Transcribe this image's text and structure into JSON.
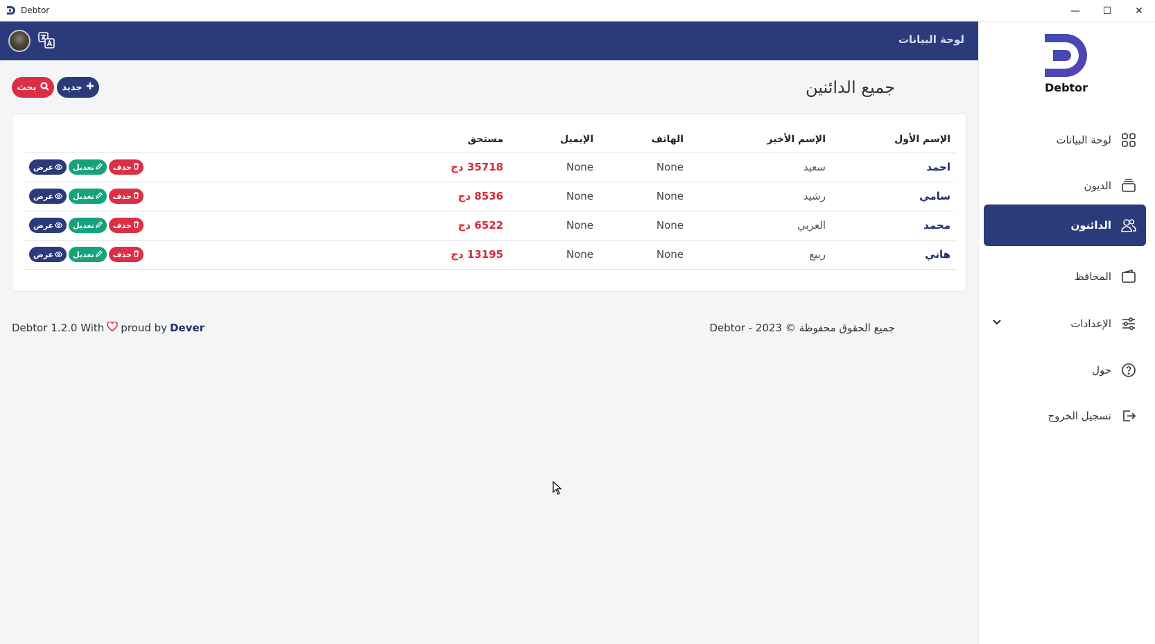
{
  "window": {
    "title": "Debtor",
    "minimize": "—",
    "maximize": "☐",
    "close": "✕"
  },
  "header": {
    "crumb": "لوحة البيانات"
  },
  "brand": {
    "name": "Debtor"
  },
  "sidebar": {
    "items": [
      {
        "label": "لوحة البيانات",
        "icon": "grid-icon"
      },
      {
        "label": "الديون",
        "icon": "stack-icon"
      },
      {
        "label": "الدائنون",
        "icon": "users-icon",
        "active": true
      },
      {
        "label": "المحافظ",
        "icon": "wallet-icon"
      },
      {
        "label": "الإعدادات",
        "icon": "sliders-icon"
      },
      {
        "label": "حول",
        "icon": "question-icon"
      },
      {
        "label": "تسجيل الخروج",
        "icon": "logout-icon"
      }
    ]
  },
  "page": {
    "title": "جميع الدائنين",
    "new_label": "جديد",
    "search_label": "بحث"
  },
  "table": {
    "headers": [
      "الإسم الأول",
      "الإسم الأخير",
      "الهاتف",
      "الإيميل",
      "مستحق"
    ],
    "rows": [
      {
        "first": "احمد",
        "last": "سعيد",
        "phone": "None",
        "email": "None",
        "owed": "35718 دج"
      },
      {
        "first": "سامي",
        "last": "رشيد",
        "phone": "None",
        "email": "None",
        "owed": "8536 دج"
      },
      {
        "first": "محمد",
        "last": "العربي",
        "phone": "None",
        "email": "None",
        "owed": "6522 دج"
      },
      {
        "first": "هاني",
        "last": "ربيع",
        "phone": "None",
        "email": "None",
        "owed": "13195 دج"
      }
    ],
    "actions": {
      "view": "عرض",
      "edit": "تعديل",
      "delete": "حذف"
    }
  },
  "footer": {
    "copyright": "جميع الحقوق محفوظة © 2023 - Debtor",
    "version_prefix": "Debtor 1.2.0 With",
    "proud_by": "proud by",
    "dev": "Dever"
  },
  "colors": {
    "primary": "#2b3a7a",
    "danger": "#dc2f45",
    "success": "#15a37c"
  }
}
